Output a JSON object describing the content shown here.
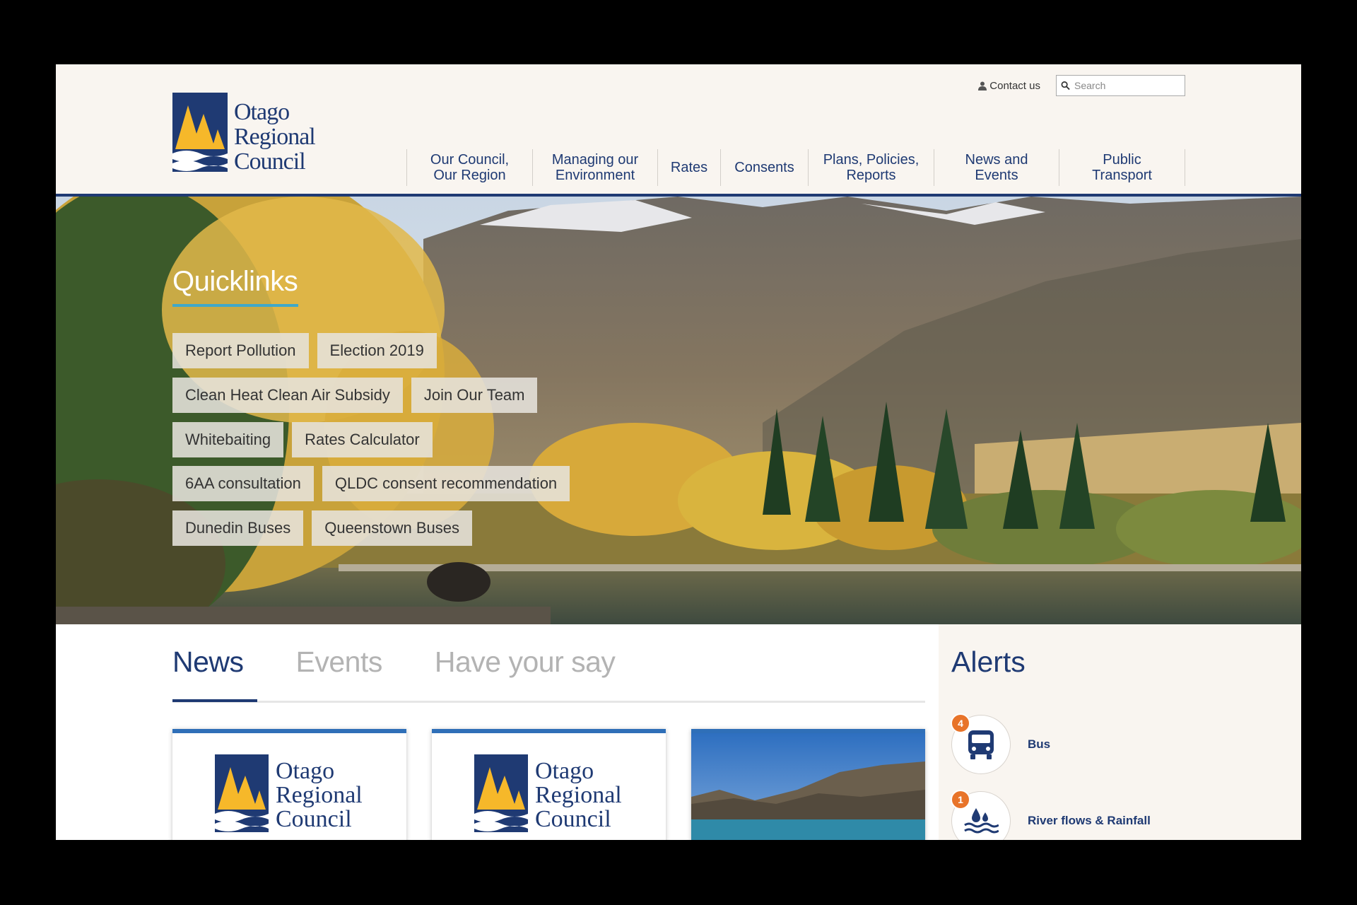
{
  "header": {
    "logo_lines": [
      "Otago",
      "Regional",
      "Council"
    ],
    "contact_label": "Contact us",
    "search_placeholder": "Search",
    "nav": [
      {
        "line1": "Our Council,",
        "line2": "Our Region"
      },
      {
        "line1": "Managing our",
        "line2": "Environment"
      },
      {
        "line1": "Rates",
        "line2": ""
      },
      {
        "line1": "Consents",
        "line2": ""
      },
      {
        "line1": "Plans, Policies,",
        "line2": "Reports"
      },
      {
        "line1": "News and",
        "line2": "Events"
      },
      {
        "line1": "Public",
        "line2": "Transport"
      }
    ]
  },
  "quicklinks": {
    "title": "Quicklinks",
    "rows": [
      [
        "Report Pollution",
        "Election 2019"
      ],
      [
        "Clean Heat Clean Air Subsidy",
        "Join Our Team"
      ],
      [
        "Whitebaiting",
        "Rates Calculator"
      ],
      [
        "6AA consultation",
        "QLDC consent recommendation"
      ],
      [
        "Dunedin Buses",
        "Queenstown Buses"
      ]
    ]
  },
  "tabs": {
    "items": [
      "News",
      "Events",
      "Have your say"
    ],
    "active": "News"
  },
  "alerts": {
    "title": "Alerts",
    "items": [
      {
        "count": "4",
        "label": "Bus",
        "icon": "bus-icon"
      },
      {
        "count": "1",
        "label": "River flows & Rainfall",
        "icon": "water-drop-icon"
      }
    ]
  },
  "colors": {
    "brand_navy": "#1f3a73",
    "brand_gold": "#f6b82a",
    "accent_blue": "#2f6fb8",
    "badge_orange": "#e8742a",
    "header_bg": "#f9f5f0"
  }
}
